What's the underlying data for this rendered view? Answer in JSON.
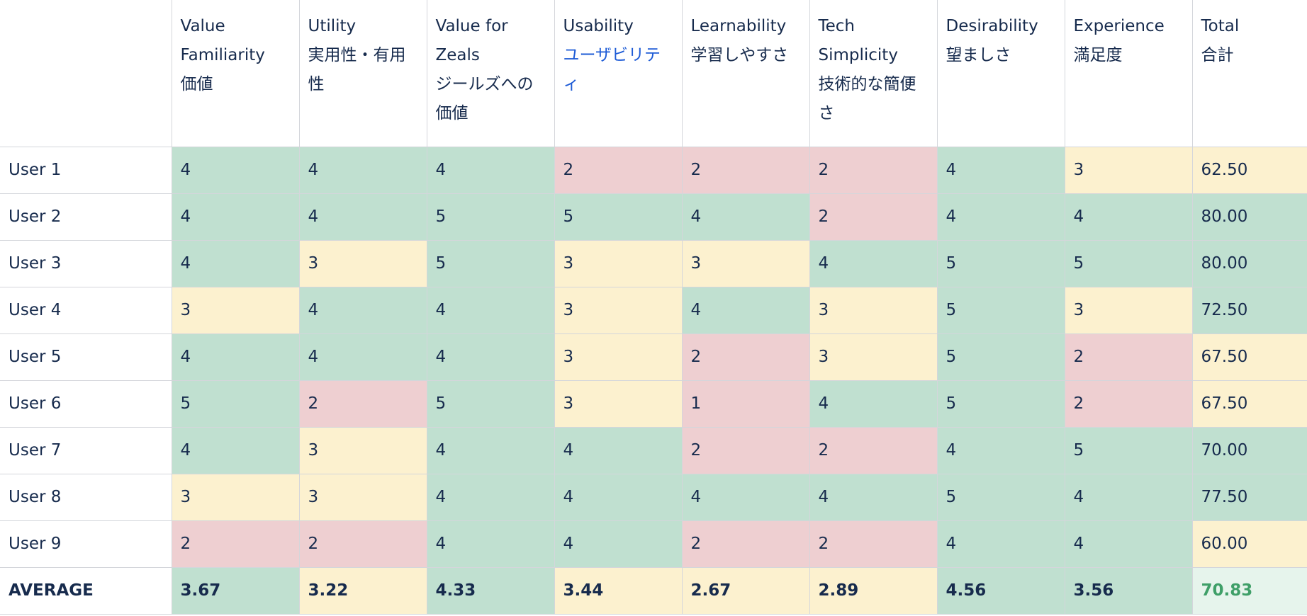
{
  "colors": {
    "good": "#c0e0d0",
    "neutral": "#fcf1cf",
    "bad": "#eecfd1",
    "link": "#1d5bd6",
    "total_average_text": "#3f9f68",
    "text": "#172b4d"
  },
  "columns": [
    {
      "en": "Value Familiarity",
      "ja": "価値"
    },
    {
      "en": "Utility",
      "ja": "実用性・有用性"
    },
    {
      "en": "Value for Zeals",
      "ja": "ジールズへの価値"
    },
    {
      "en": "Usability",
      "ja": "ユーザビリティ",
      "link": true
    },
    {
      "en": "Learnability",
      "ja": "学習しやすさ"
    },
    {
      "en": "Tech Simplicity",
      "ja": "技術的な簡便さ"
    },
    {
      "en": "Desirability",
      "ja": "望ましさ"
    },
    {
      "en": "Experience",
      "ja": "満足度"
    },
    {
      "en": "Total",
      "ja": "合計"
    }
  ],
  "rows": [
    {
      "label": "User 1",
      "cells": [
        {
          "v": "4",
          "s": "g"
        },
        {
          "v": "4",
          "s": "g"
        },
        {
          "v": "4",
          "s": "g"
        },
        {
          "v": "2",
          "s": "r"
        },
        {
          "v": "2",
          "s": "r"
        },
        {
          "v": "2",
          "s": "r"
        },
        {
          "v": "4",
          "s": "g"
        },
        {
          "v": "3",
          "s": "y"
        },
        {
          "v": "62.50",
          "s": "y"
        }
      ]
    },
    {
      "label": "User 2",
      "cells": [
        {
          "v": "4",
          "s": "g"
        },
        {
          "v": "4",
          "s": "g"
        },
        {
          "v": "5",
          "s": "g"
        },
        {
          "v": "5",
          "s": "g"
        },
        {
          "v": "4",
          "s": "g"
        },
        {
          "v": "2",
          "s": "r"
        },
        {
          "v": "4",
          "s": "g"
        },
        {
          "v": "4",
          "s": "g"
        },
        {
          "v": "80.00",
          "s": "g"
        }
      ]
    },
    {
      "label": "User 3",
      "cells": [
        {
          "v": "4",
          "s": "g"
        },
        {
          "v": "3",
          "s": "y"
        },
        {
          "v": "5",
          "s": "g"
        },
        {
          "v": "3",
          "s": "y"
        },
        {
          "v": "3",
          "s": "y"
        },
        {
          "v": "4",
          "s": "g"
        },
        {
          "v": "5",
          "s": "g"
        },
        {
          "v": "5",
          "s": "g"
        },
        {
          "v": "80.00",
          "s": "g"
        }
      ]
    },
    {
      "label": "User 4",
      "cells": [
        {
          "v": "3",
          "s": "y"
        },
        {
          "v": "4",
          "s": "g"
        },
        {
          "v": "4",
          "s": "g"
        },
        {
          "v": "3",
          "s": "y"
        },
        {
          "v": "4",
          "s": "g"
        },
        {
          "v": "3",
          "s": "y"
        },
        {
          "v": "5",
          "s": "g"
        },
        {
          "v": "3",
          "s": "y"
        },
        {
          "v": "72.50",
          "s": "g"
        }
      ]
    },
    {
      "label": "User 5",
      "cells": [
        {
          "v": "4",
          "s": "g"
        },
        {
          "v": "4",
          "s": "g"
        },
        {
          "v": "4",
          "s": "g"
        },
        {
          "v": "3",
          "s": "y"
        },
        {
          "v": "2",
          "s": "r"
        },
        {
          "v": "3",
          "s": "y"
        },
        {
          "v": "5",
          "s": "g"
        },
        {
          "v": "2",
          "s": "r"
        },
        {
          "v": "67.50",
          "s": "y"
        }
      ]
    },
    {
      "label": "User 6",
      "cells": [
        {
          "v": "5",
          "s": "g"
        },
        {
          "v": "2",
          "s": "r"
        },
        {
          "v": "5",
          "s": "g"
        },
        {
          "v": "3",
          "s": "y"
        },
        {
          "v": "1",
          "s": "r"
        },
        {
          "v": "4",
          "s": "g"
        },
        {
          "v": "5",
          "s": "g"
        },
        {
          "v": "2",
          "s": "r"
        },
        {
          "v": "67.50",
          "s": "y"
        }
      ]
    },
    {
      "label": "User 7",
      "cells": [
        {
          "v": "4",
          "s": "g"
        },
        {
          "v": "3",
          "s": "y"
        },
        {
          "v": "4",
          "s": "g"
        },
        {
          "v": "4",
          "s": "g"
        },
        {
          "v": "2",
          "s": "r"
        },
        {
          "v": "2",
          "s": "r"
        },
        {
          "v": "4",
          "s": "g"
        },
        {
          "v": "5",
          "s": "g"
        },
        {
          "v": "70.00",
          "s": "g"
        }
      ]
    },
    {
      "label": "User 8",
      "cells": [
        {
          "v": "3",
          "s": "y"
        },
        {
          "v": "3",
          "s": "y"
        },
        {
          "v": "4",
          "s": "g"
        },
        {
          "v": "4",
          "s": "g"
        },
        {
          "v": "4",
          "s": "g"
        },
        {
          "v": "4",
          "s": "g"
        },
        {
          "v": "5",
          "s": "g"
        },
        {
          "v": "4",
          "s": "g"
        },
        {
          "v": "77.50",
          "s": "g"
        }
      ]
    },
    {
      "label": "User 9",
      "cells": [
        {
          "v": "2",
          "s": "r"
        },
        {
          "v": "2",
          "s": "r"
        },
        {
          "v": "4",
          "s": "g"
        },
        {
          "v": "4",
          "s": "g"
        },
        {
          "v": "2",
          "s": "r"
        },
        {
          "v": "2",
          "s": "r"
        },
        {
          "v": "4",
          "s": "g"
        },
        {
          "v": "4",
          "s": "g"
        },
        {
          "v": "60.00",
          "s": "y"
        }
      ]
    }
  ],
  "average": {
    "label": "AVERAGE",
    "cells": [
      {
        "v": "3.67",
        "s": "g"
      },
      {
        "v": "3.22",
        "s": "y"
      },
      {
        "v": "4.33",
        "s": "g"
      },
      {
        "v": "3.44",
        "s": "y"
      },
      {
        "v": "2.67",
        "s": "y"
      },
      {
        "v": "2.89",
        "s": "y"
      },
      {
        "v": "4.56",
        "s": "g"
      },
      {
        "v": "3.56",
        "s": "g"
      },
      {
        "v": "70.83",
        "s": "tot-avg"
      }
    ]
  }
}
